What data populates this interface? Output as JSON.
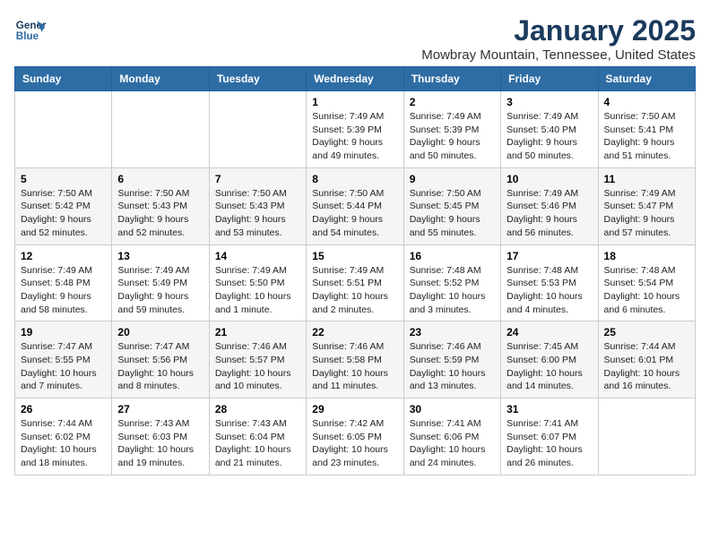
{
  "header": {
    "logo_line1": "General",
    "logo_line2": "Blue",
    "month": "January 2025",
    "location": "Mowbray Mountain, Tennessee, United States"
  },
  "weekdays": [
    "Sunday",
    "Monday",
    "Tuesday",
    "Wednesday",
    "Thursday",
    "Friday",
    "Saturday"
  ],
  "rows": [
    [
      {
        "day": "",
        "info": ""
      },
      {
        "day": "",
        "info": ""
      },
      {
        "day": "",
        "info": ""
      },
      {
        "day": "1",
        "info": "Sunrise: 7:49 AM\nSunset: 5:39 PM\nDaylight: 9 hours\nand 49 minutes."
      },
      {
        "day": "2",
        "info": "Sunrise: 7:49 AM\nSunset: 5:39 PM\nDaylight: 9 hours\nand 50 minutes."
      },
      {
        "day": "3",
        "info": "Sunrise: 7:49 AM\nSunset: 5:40 PM\nDaylight: 9 hours\nand 50 minutes."
      },
      {
        "day": "4",
        "info": "Sunrise: 7:50 AM\nSunset: 5:41 PM\nDaylight: 9 hours\nand 51 minutes."
      }
    ],
    [
      {
        "day": "5",
        "info": "Sunrise: 7:50 AM\nSunset: 5:42 PM\nDaylight: 9 hours\nand 52 minutes."
      },
      {
        "day": "6",
        "info": "Sunrise: 7:50 AM\nSunset: 5:43 PM\nDaylight: 9 hours\nand 52 minutes."
      },
      {
        "day": "7",
        "info": "Sunrise: 7:50 AM\nSunset: 5:43 PM\nDaylight: 9 hours\nand 53 minutes."
      },
      {
        "day": "8",
        "info": "Sunrise: 7:50 AM\nSunset: 5:44 PM\nDaylight: 9 hours\nand 54 minutes."
      },
      {
        "day": "9",
        "info": "Sunrise: 7:50 AM\nSunset: 5:45 PM\nDaylight: 9 hours\nand 55 minutes."
      },
      {
        "day": "10",
        "info": "Sunrise: 7:49 AM\nSunset: 5:46 PM\nDaylight: 9 hours\nand 56 minutes."
      },
      {
        "day": "11",
        "info": "Sunrise: 7:49 AM\nSunset: 5:47 PM\nDaylight: 9 hours\nand 57 minutes."
      }
    ],
    [
      {
        "day": "12",
        "info": "Sunrise: 7:49 AM\nSunset: 5:48 PM\nDaylight: 9 hours\nand 58 minutes."
      },
      {
        "day": "13",
        "info": "Sunrise: 7:49 AM\nSunset: 5:49 PM\nDaylight: 9 hours\nand 59 minutes."
      },
      {
        "day": "14",
        "info": "Sunrise: 7:49 AM\nSunset: 5:50 PM\nDaylight: 10 hours\nand 1 minute."
      },
      {
        "day": "15",
        "info": "Sunrise: 7:49 AM\nSunset: 5:51 PM\nDaylight: 10 hours\nand 2 minutes."
      },
      {
        "day": "16",
        "info": "Sunrise: 7:48 AM\nSunset: 5:52 PM\nDaylight: 10 hours\nand 3 minutes."
      },
      {
        "day": "17",
        "info": "Sunrise: 7:48 AM\nSunset: 5:53 PM\nDaylight: 10 hours\nand 4 minutes."
      },
      {
        "day": "18",
        "info": "Sunrise: 7:48 AM\nSunset: 5:54 PM\nDaylight: 10 hours\nand 6 minutes."
      }
    ],
    [
      {
        "day": "19",
        "info": "Sunrise: 7:47 AM\nSunset: 5:55 PM\nDaylight: 10 hours\nand 7 minutes."
      },
      {
        "day": "20",
        "info": "Sunrise: 7:47 AM\nSunset: 5:56 PM\nDaylight: 10 hours\nand 8 minutes."
      },
      {
        "day": "21",
        "info": "Sunrise: 7:46 AM\nSunset: 5:57 PM\nDaylight: 10 hours\nand 10 minutes."
      },
      {
        "day": "22",
        "info": "Sunrise: 7:46 AM\nSunset: 5:58 PM\nDaylight: 10 hours\nand 11 minutes."
      },
      {
        "day": "23",
        "info": "Sunrise: 7:46 AM\nSunset: 5:59 PM\nDaylight: 10 hours\nand 13 minutes."
      },
      {
        "day": "24",
        "info": "Sunrise: 7:45 AM\nSunset: 6:00 PM\nDaylight: 10 hours\nand 14 minutes."
      },
      {
        "day": "25",
        "info": "Sunrise: 7:44 AM\nSunset: 6:01 PM\nDaylight: 10 hours\nand 16 minutes."
      }
    ],
    [
      {
        "day": "26",
        "info": "Sunrise: 7:44 AM\nSunset: 6:02 PM\nDaylight: 10 hours\nand 18 minutes."
      },
      {
        "day": "27",
        "info": "Sunrise: 7:43 AM\nSunset: 6:03 PM\nDaylight: 10 hours\nand 19 minutes."
      },
      {
        "day": "28",
        "info": "Sunrise: 7:43 AM\nSunset: 6:04 PM\nDaylight: 10 hours\nand 21 minutes."
      },
      {
        "day": "29",
        "info": "Sunrise: 7:42 AM\nSunset: 6:05 PM\nDaylight: 10 hours\nand 23 minutes."
      },
      {
        "day": "30",
        "info": "Sunrise: 7:41 AM\nSunset: 6:06 PM\nDaylight: 10 hours\nand 24 minutes."
      },
      {
        "day": "31",
        "info": "Sunrise: 7:41 AM\nSunset: 6:07 PM\nDaylight: 10 hours\nand 26 minutes."
      },
      {
        "day": "",
        "info": ""
      }
    ]
  ]
}
